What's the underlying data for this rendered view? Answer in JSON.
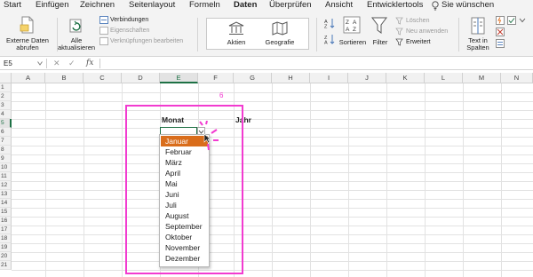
{
  "ribbon_tabs": [
    "Start",
    "Einfügen",
    "Zeichnen",
    "Seitenlayout",
    "Formeln",
    "Daten",
    "Überprüfen",
    "Ansicht",
    "Entwicklertools"
  ],
  "active_tab": "Daten",
  "tell_me": "Sie wünschen",
  "ribbon": {
    "get_data": "Externe Daten\nabrufen",
    "refresh_all": "Alle\naktualisieren",
    "connections": "Verbindungen",
    "properties": "Eigenschaften",
    "edit_links": "Verknüpfungen bearbeiten",
    "stocks": "Aktien",
    "geography": "Geografie",
    "sort": "Sortieren",
    "filter": "Filter",
    "clear": "Löschen",
    "reapply": "Neu anwenden",
    "advanced": "Erweitert",
    "text_to_columns": "Text in\nSpalten"
  },
  "formula_bar": {
    "name_box": "E5",
    "cancel": "✕",
    "confirm": "✓",
    "fx": "fx",
    "value": ""
  },
  "columns": [
    "A",
    "B",
    "C",
    "D",
    "E",
    "F",
    "G",
    "H",
    "I",
    "J",
    "K",
    "L",
    "M",
    "N"
  ],
  "selected_column": "E",
  "rows": [
    "1",
    "2",
    "3",
    "4",
    "5",
    "6",
    "7",
    "8",
    "9",
    "10",
    "11",
    "12",
    "13",
    "14",
    "15",
    "16",
    "17",
    "18",
    "19",
    "20",
    "21"
  ],
  "selected_row": "5",
  "cells": {
    "E4": "Monat",
    "G4": "Jahr"
  },
  "annotation_number": "6",
  "dropdown": {
    "items": [
      "Januar",
      "Februar",
      "März",
      "April",
      "Mai",
      "Juni",
      "Juli",
      "August",
      "September",
      "Oktober",
      "November",
      "Dezember"
    ],
    "highlighted": "Januar"
  },
  "colors": {
    "accent": "#1e7145",
    "annotation": "#f23bd0",
    "highlight": "#d96d1b"
  }
}
